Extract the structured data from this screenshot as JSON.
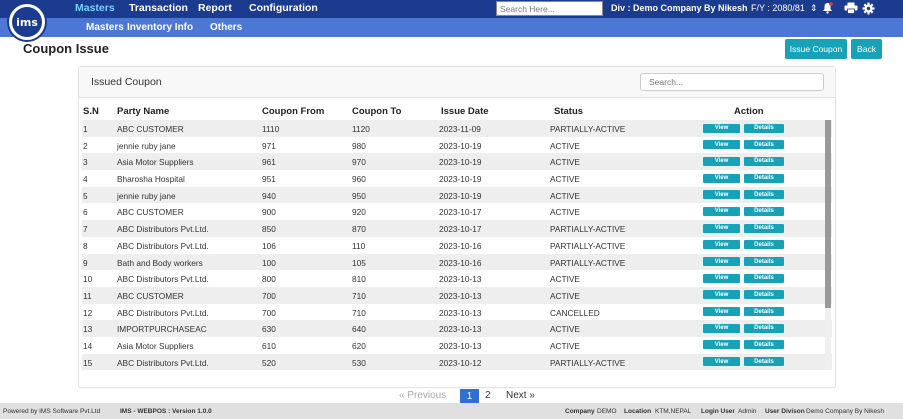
{
  "logo_text": "ims",
  "nav": {
    "items": [
      "Masters",
      "Transaction",
      "Report",
      "Configuration"
    ],
    "sub_items": [
      "Masters",
      "Inventory Info",
      "Others"
    ],
    "search_placeholder": "Search Here...",
    "div_label": "Div : Demo Company By Nikesh",
    "fy_label": "F/Y :  2080/81",
    "icons": [
      "chevron-updown-icon",
      "bell-icon",
      "print-icon",
      "gear-icon"
    ]
  },
  "page": {
    "title": "Coupon Issue",
    "issue_button": "Issue Coupon",
    "back_button": "Back"
  },
  "card": {
    "title": "Issued Coupon",
    "search_placeholder": "Search..."
  },
  "table": {
    "headers": [
      "S.N",
      "Party Name",
      "Coupon From",
      "Coupon To",
      "Issue Date",
      "Status",
      "Action"
    ],
    "view_label": "View",
    "details_label": "Details",
    "rows": [
      {
        "sn": "1",
        "party": "ABC CUSTOMER",
        "from": "1110",
        "to": "1120",
        "date": "2023-11-09",
        "status": "PARTIALLY-ACTIVE"
      },
      {
        "sn": "2",
        "party": "jennie ruby jane",
        "from": "971",
        "to": "980",
        "date": "2023-10-19",
        "status": "ACTIVE"
      },
      {
        "sn": "3",
        "party": "Asia Motor Suppliers",
        "from": "961",
        "to": "970",
        "date": "2023-10-19",
        "status": "ACTIVE"
      },
      {
        "sn": "4",
        "party": "Bharosha Hospital",
        "from": "951",
        "to": "960",
        "date": "2023-10-19",
        "status": "ACTIVE"
      },
      {
        "sn": "5",
        "party": "jennie ruby jane",
        "from": "940",
        "to": "950",
        "date": "2023-10-19",
        "status": "ACTIVE"
      },
      {
        "sn": "6",
        "party": "ABC CUSTOMER",
        "from": "900",
        "to": "920",
        "date": "2023-10-17",
        "status": "ACTIVE"
      },
      {
        "sn": "7",
        "party": "ABC Distributors Pvt.Ltd.",
        "from": "850",
        "to": "870",
        "date": "2023-10-17",
        "status": "PARTIALLY-ACTIVE"
      },
      {
        "sn": "8",
        "party": "ABC Distributors Pvt.Ltd.",
        "from": "106",
        "to": "110",
        "date": "2023-10-16",
        "status": "PARTIALLY-ACTIVE"
      },
      {
        "sn": "9",
        "party": "Bath and Body workers",
        "from": "100",
        "to": "105",
        "date": "2023-10-16",
        "status": "PARTIALLY-ACTIVE"
      },
      {
        "sn": "10",
        "party": "ABC Distributors Pvt.Ltd.",
        "from": "800",
        "to": "810",
        "date": "2023-10-13",
        "status": "ACTIVE"
      },
      {
        "sn": "11",
        "party": "ABC CUSTOMER",
        "from": "700",
        "to": "710",
        "date": "2023-10-13",
        "status": "ACTIVE"
      },
      {
        "sn": "12",
        "party": "ABC Distributors Pvt.Ltd.",
        "from": "700",
        "to": "710",
        "date": "2023-10-13",
        "status": "CANCELLED"
      },
      {
        "sn": "13",
        "party": "IMPORTPURCHASEAC",
        "from": "630",
        "to": "640",
        "date": "2023-10-13",
        "status": "ACTIVE"
      },
      {
        "sn": "14",
        "party": "Asia Motor Suppliers",
        "from": "610",
        "to": "620",
        "date": "2023-10-13",
        "status": "ACTIVE"
      },
      {
        "sn": "15",
        "party": "ABC Distributors Pvt.Ltd.",
        "from": "520",
        "to": "530",
        "date": "2023-10-12",
        "status": "PARTIALLY-ACTIVE"
      }
    ]
  },
  "pagination": {
    "previous": "« Previous",
    "pages": [
      "1",
      "2"
    ],
    "current": "1",
    "next": "Next »"
  },
  "footer": {
    "powered_by": "Powered by IMS Software Pvt.Ltd",
    "version": "IMS - WEBPOS : Version 1.0.0",
    "company_label": "Company",
    "company_value": "DEMO",
    "location_label": "Location",
    "location_value": "KTM,NEPAL",
    "login_label": "Login User",
    "login_value": "Admin",
    "division_label": "User Divison",
    "division_value": "Demo Company By Nikesh"
  },
  "colors": {
    "topbar": "#1b3b8f",
    "subbar": "#4c78d4",
    "accent": "#17a2b8",
    "active_nav": "#7ad0ff"
  }
}
